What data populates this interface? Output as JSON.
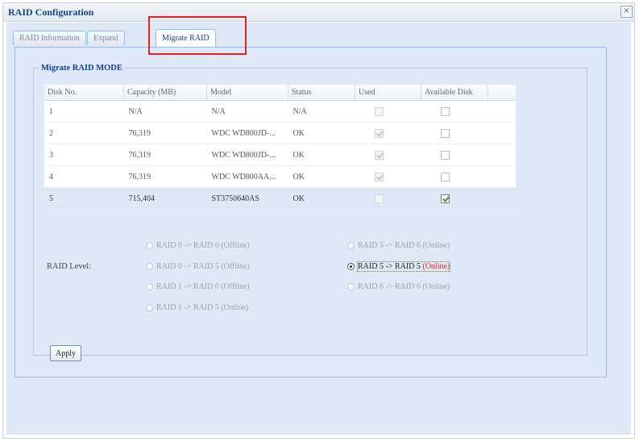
{
  "window": {
    "title": "RAID Configuration",
    "close_glyph": "×"
  },
  "tabs": [
    {
      "label": "RAID Information",
      "active": false
    },
    {
      "label": "Expand",
      "active": false
    },
    {
      "label": "Migrate RAID",
      "active": true
    }
  ],
  "section": {
    "legend": "Migrate RAID MODE"
  },
  "table": {
    "columns": [
      "Disk No.",
      "Capacity (MB)",
      "Model",
      "Status",
      "Used",
      "Available Disk"
    ],
    "rows": [
      {
        "disk": "1",
        "capacity": "N/A",
        "model": "N/A",
        "status": "N/A",
        "used": false,
        "used_disabled": true,
        "available": false
      },
      {
        "disk": "2",
        "capacity": "76,319",
        "model": "WDC WD800JD-...",
        "status": "OK",
        "used": true,
        "used_disabled": true,
        "available": false
      },
      {
        "disk": "3",
        "capacity": "76,319",
        "model": "WDC WD800JD-...",
        "status": "OK",
        "used": true,
        "used_disabled": true,
        "available": false
      },
      {
        "disk": "4",
        "capacity": "76,319",
        "model": "WDC WD800AA...",
        "status": "OK",
        "used": true,
        "used_disabled": true,
        "available": false
      },
      {
        "disk": "5",
        "capacity": "715,404",
        "model": "ST3750640AS",
        "status": "OK",
        "used": false,
        "used_disabled": true,
        "available": true,
        "selected": true
      }
    ]
  },
  "raid_level": {
    "label": "RAID Level:",
    "options": [
      {
        "text": "RAID 0 -> RAID 0 (Offline)",
        "selected": false
      },
      {
        "text": "RAID 0 -> RAID 5 (Offline)",
        "selected": false
      },
      {
        "text": "RAID 1 -> RAID 0 (Offline)",
        "selected": false
      },
      {
        "text": "RAID 1 -> RAID 5 (Online)",
        "selected": false
      },
      {
        "text": "RAID 5 -> RAID 6 (Online)",
        "selected": false
      },
      {
        "text": "RAID 5 -> RAID 5",
        "suffix": "(Online)",
        "selected": true
      },
      {
        "text": "RAID 6 -> RAID 6 (Online)",
        "selected": false
      }
    ]
  },
  "apply_label": "Apply",
  "colors": {
    "accent_red": "#e0231f",
    "online_red": "#d42e2e",
    "panel_bg": "#dfe8f6"
  }
}
